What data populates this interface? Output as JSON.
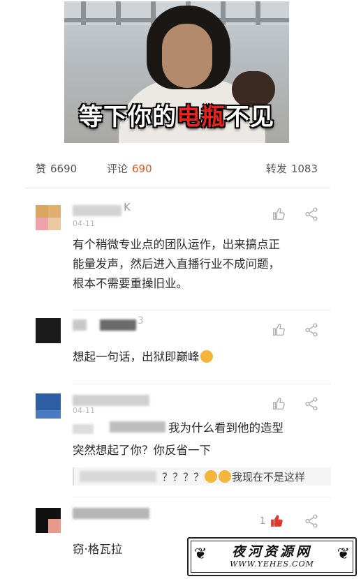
{
  "meme": {
    "caption_before": "等下你的",
    "caption_highlight": "电瓶",
    "caption_after": "不见"
  },
  "stats": {
    "like_label": "赞",
    "like_count": "6690",
    "comment_label": "评论",
    "comment_count": "690",
    "repost_label": "转发",
    "repost_count": "1083"
  },
  "comments": [
    {
      "name_tail": "K",
      "date": "04-11",
      "text_lines": [
        "有个稍微专业点的团队运作，出来搞点正",
        "能量发声，然后进入直播行业不成问题，",
        "根本不需要重操旧业。"
      ]
    },
    {
      "name_tail": "3",
      "text": "想起一句话，出狱即巅峰"
    },
    {
      "date": "04-11",
      "reply_text_line1": "我为什么看到他的造型",
      "reply_text_line2": "突然想起了你？你反省一下",
      "quote_text": "？？？？",
      "quote_tail": "我现在不是这样"
    },
    {
      "likes": "1",
      "text": "窃·格瓦拉"
    }
  ],
  "watermark": {
    "title": "夜河资源网",
    "url": "WWW.YEHES.COM"
  },
  "colors": {
    "accent": "#e8541f",
    "liked": "#e03a2f"
  },
  "icons": [
    "thumbs-up-icon",
    "share-icon"
  ]
}
